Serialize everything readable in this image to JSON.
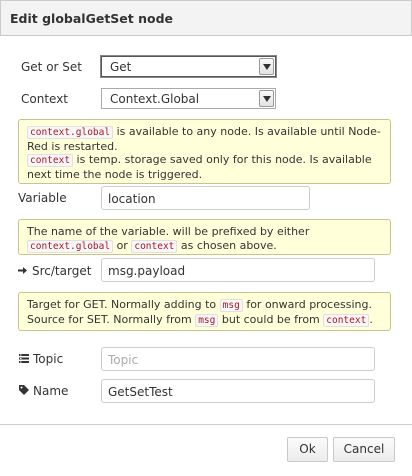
{
  "dialog": {
    "title": "Edit globalGetSet node"
  },
  "fields": {
    "get_or_set": {
      "label": "Get or Set",
      "value": "Get"
    },
    "context": {
      "label": "Context",
      "value": "Context.Global"
    },
    "variable": {
      "label": "Variable",
      "value": "location"
    },
    "src_target": {
      "label": "Src/target",
      "value": "msg.payload",
      "icon": "arrow-right-icon"
    },
    "topic": {
      "label": "Topic",
      "placeholder": "Topic",
      "icon": "tasks-icon"
    },
    "name": {
      "label": "Name",
      "value": "GetSetTest",
      "icon": "tag-icon"
    }
  },
  "tips": {
    "context": {
      "code1": "context.global",
      "text1": " is available to any node. Is available until Node-Red is restarted.",
      "code2": "context",
      "text2": " is temp. storage saved only for this node. Is available next time the node is triggered."
    },
    "variable": {
      "text1": "The name of the variable. will be prefixed by either",
      "code1": "context.global",
      "text2": "or",
      "code2": "context",
      "text3": "as chosen above."
    },
    "target": {
      "text1": "Target for GET. Normally adding to ",
      "code1": "msg",
      "text2": " for onward processing. Source for SET. Normally from ",
      "code2": "msg",
      "text3": " but could be from ",
      "code3": "context",
      "text4": "."
    }
  },
  "buttons": {
    "ok": "Ok",
    "cancel": "Cancel"
  },
  "colors": {
    "tip_bg": "#ffffd9",
    "tip_border": "#c8c38b",
    "code_text": "#ad1625"
  }
}
